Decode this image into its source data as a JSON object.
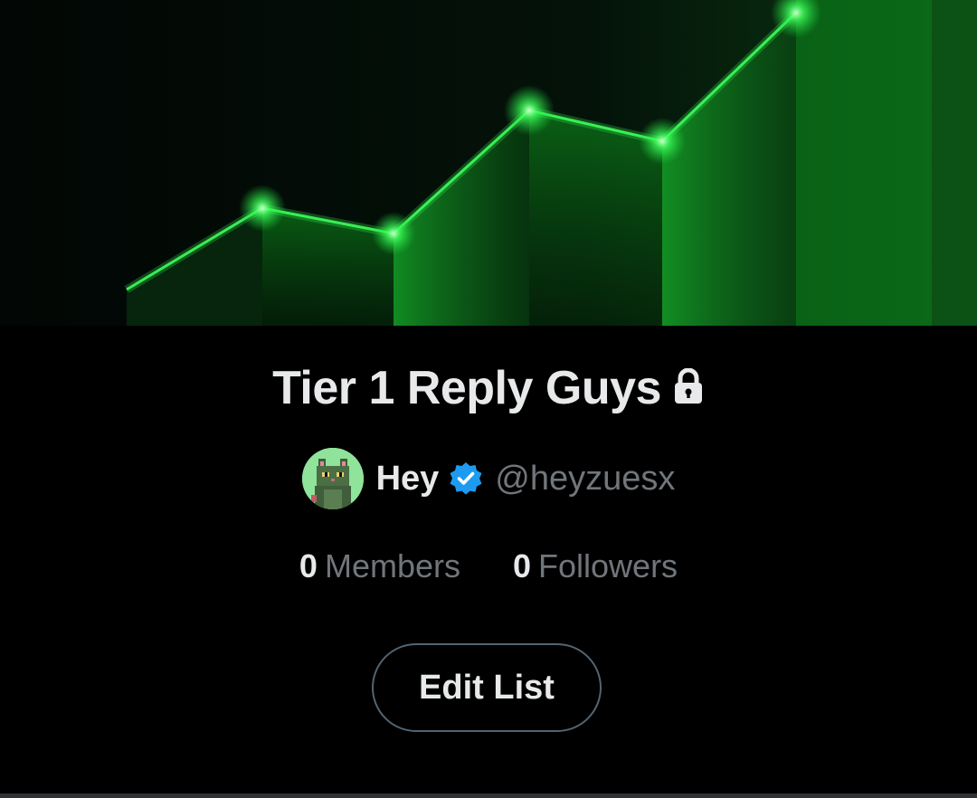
{
  "list": {
    "title": "Tier 1 Reply Guys",
    "private_icon": "lock-icon"
  },
  "owner": {
    "display_name": "Hey",
    "verified_icon": "verified-badge-icon",
    "handle": "@heyzuesx",
    "avatar_icon": "pixel-cat-avatar"
  },
  "stats": {
    "members_count": "0",
    "members_label": "Members",
    "followers_count": "0",
    "followers_label": "Followers"
  },
  "actions": {
    "edit_label": "Edit List"
  },
  "colors": {
    "background": "#000000",
    "text_primary": "#e7e9ea",
    "text_secondary": "#71767b",
    "verified_blue": "#1d9bf0",
    "banner_green": "#1fd13a"
  }
}
